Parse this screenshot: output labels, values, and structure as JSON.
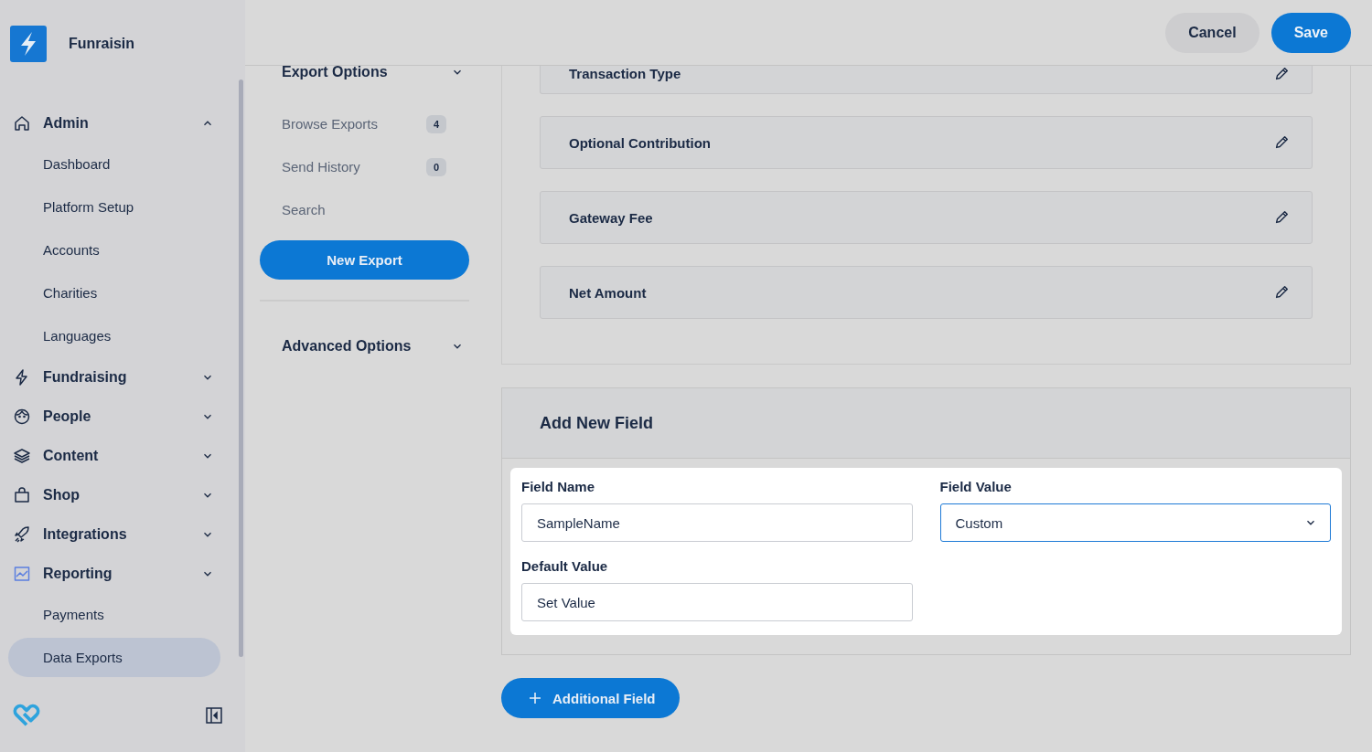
{
  "brand": {
    "name": "Funraisin"
  },
  "sidebar": {
    "sections": [
      {
        "label": "Admin",
        "expanded": true,
        "items": [
          {
            "label": "Dashboard",
            "selected": false
          },
          {
            "label": "Platform Setup",
            "selected": false
          },
          {
            "label": "Accounts",
            "selected": false
          },
          {
            "label": "Charities",
            "selected": false
          },
          {
            "label": "Languages",
            "selected": false
          }
        ]
      },
      {
        "label": "Fundraising",
        "expanded": false
      },
      {
        "label": "People",
        "expanded": false
      },
      {
        "label": "Content",
        "expanded": false
      },
      {
        "label": "Shop",
        "expanded": false
      },
      {
        "label": "Integrations",
        "expanded": false
      },
      {
        "label": "Reporting",
        "expanded": false,
        "items": [
          {
            "label": "Payments",
            "selected": false
          },
          {
            "label": "Data Exports",
            "selected": true
          }
        ]
      }
    ]
  },
  "header": {
    "buttons": [
      {
        "label": "Cancel",
        "kind": "secondary"
      },
      {
        "label": "Save",
        "kind": "primary"
      }
    ]
  },
  "export_nav": {
    "title": "Export Options",
    "items": [
      {
        "label": "Browse Exports",
        "count": "4"
      },
      {
        "label": "Send History",
        "count": "0"
      },
      {
        "label": "Search"
      }
    ],
    "button": "New Export",
    "advanced": "Advanced Options"
  },
  "fields": [
    "Transaction Type",
    "Optional Contribution",
    "Gateway Fee",
    "Net Amount"
  ],
  "add_field": {
    "title": "Add New Field",
    "field_name_label": "Field Name",
    "field_name_value": "SampleName",
    "field_value_label": "Field Value",
    "field_value": "Custom",
    "default_label": "Default Value",
    "default_value": "Set Value"
  },
  "additional_button": "Additional Field"
}
